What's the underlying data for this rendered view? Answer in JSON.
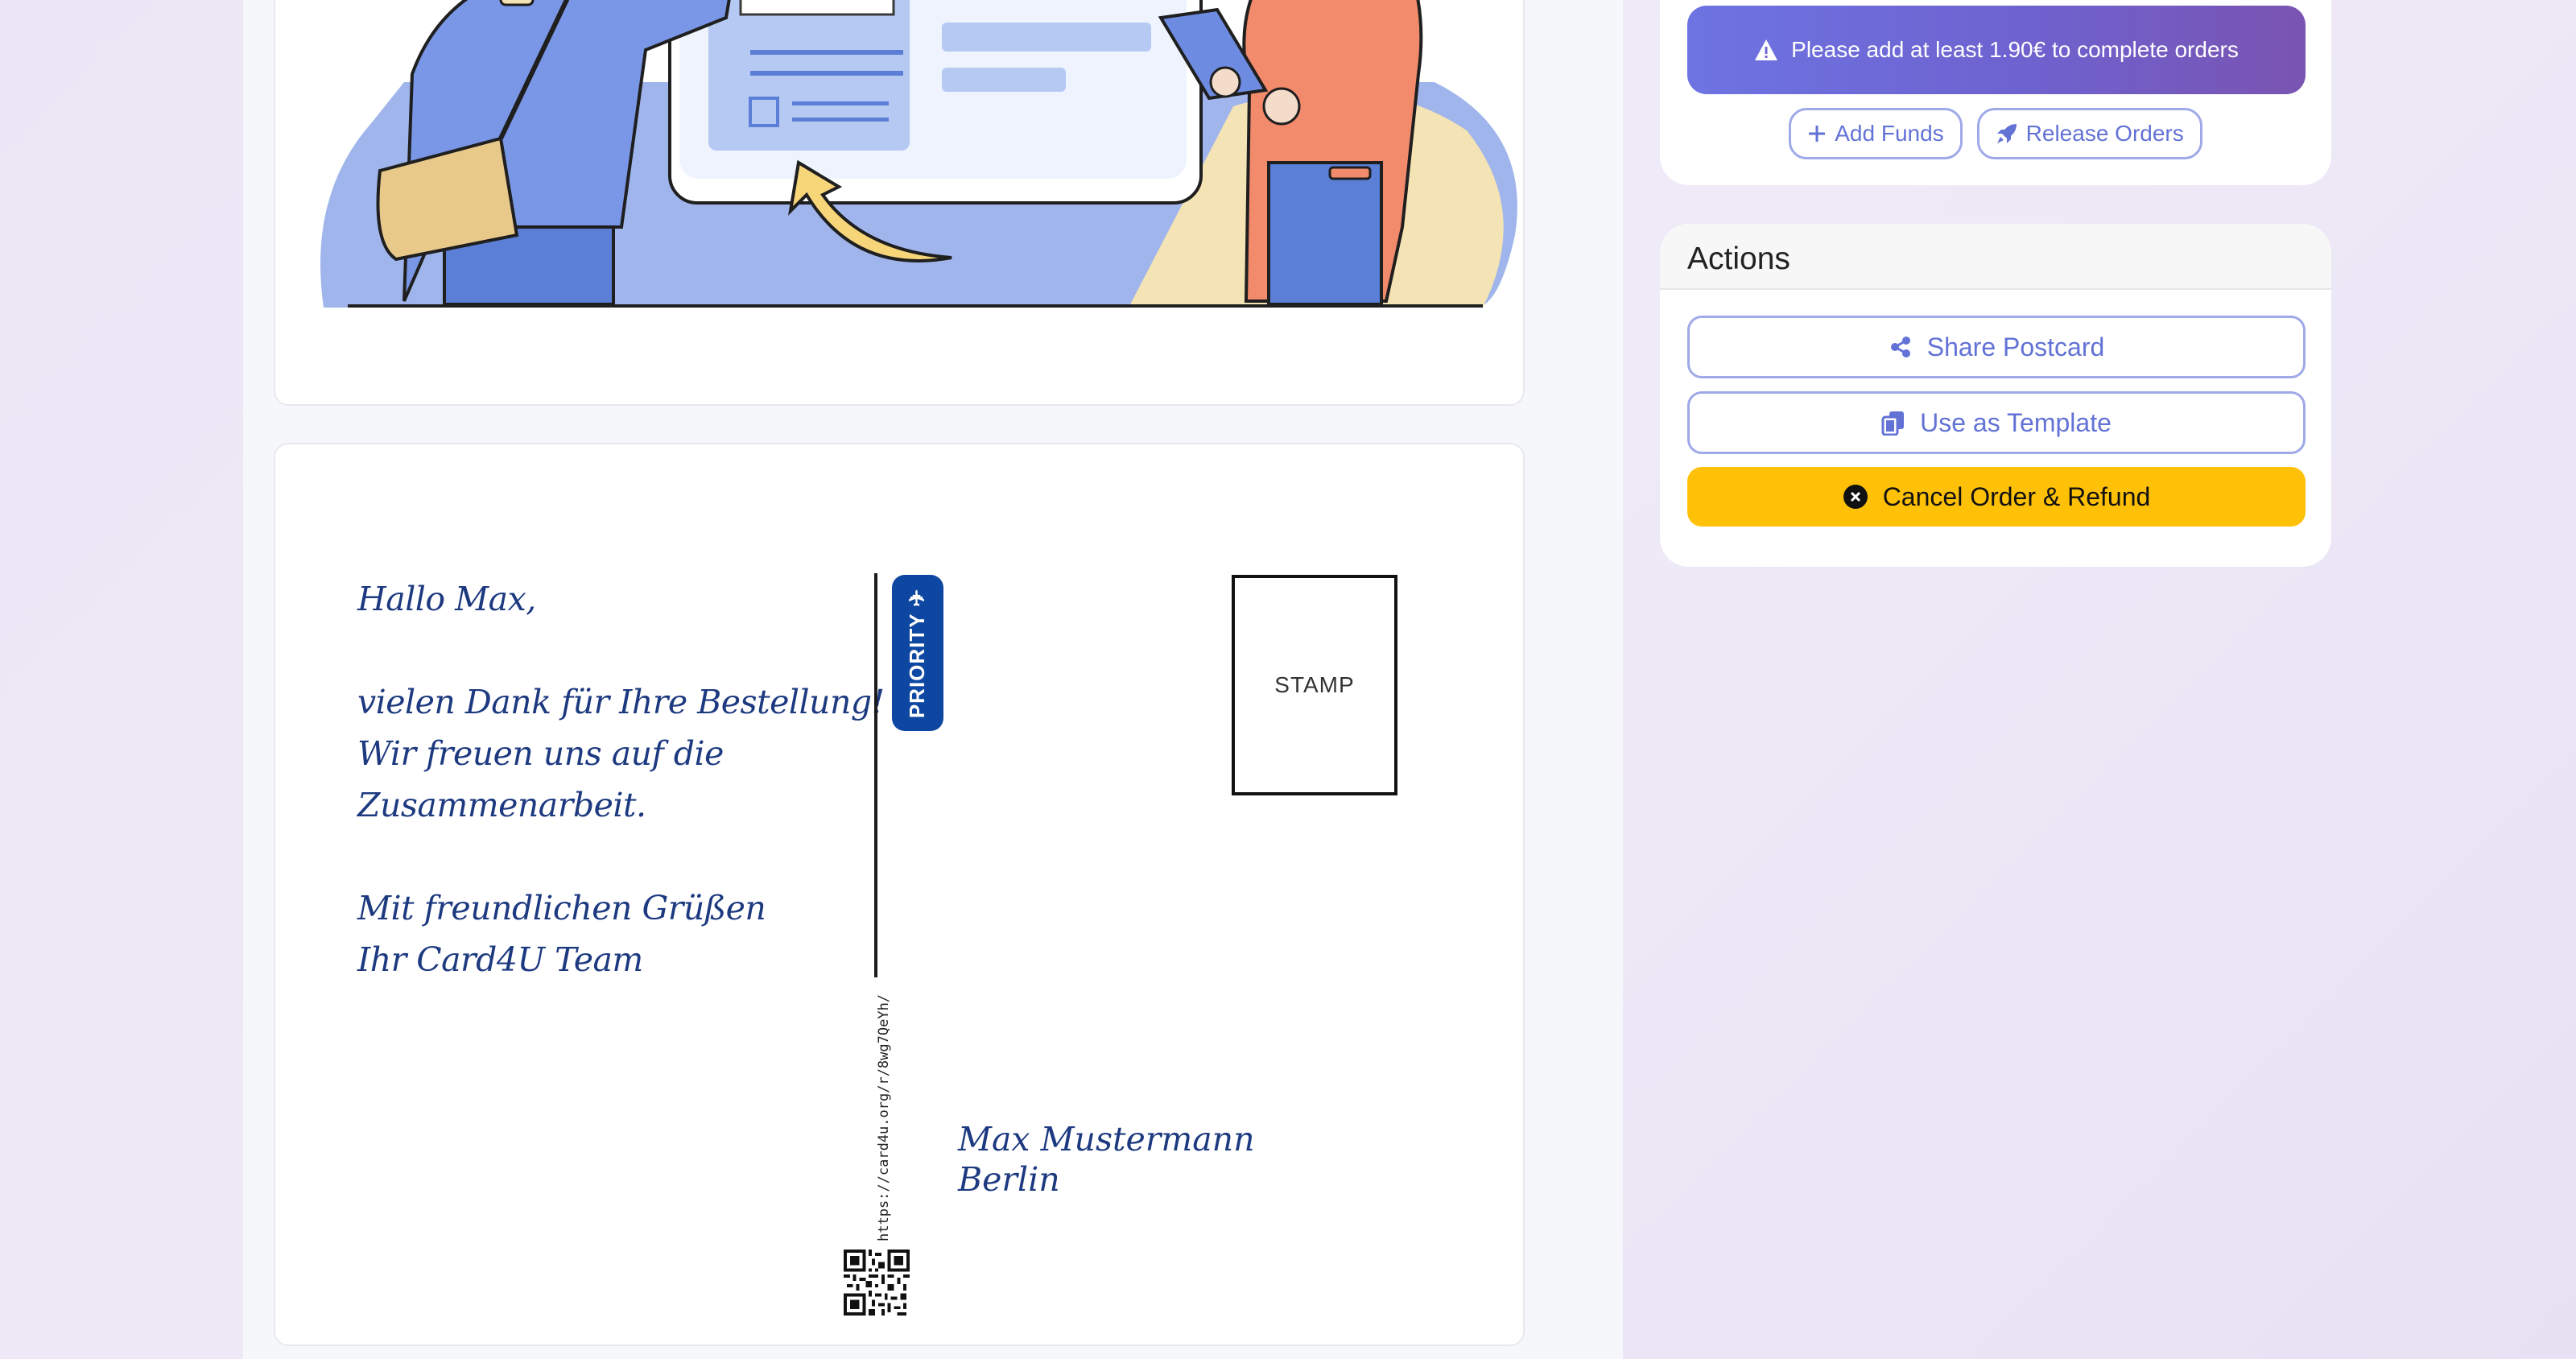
{
  "funds": {
    "alert_text": "Please add at least 1.90€ to complete orders",
    "add_funds_label": "Add Funds",
    "release_orders_label": "Release Orders"
  },
  "actions": {
    "title": "Actions",
    "share_label": "Share Postcard",
    "template_label": "Use as Template",
    "cancel_label": "Cancel Order & Refund"
  },
  "postcard": {
    "greeting": "Hallo Max,",
    "body_lines": [
      "vielen Dank für Ihre Bestellung!",
      "Wir freuen uns auf die",
      "Zusammenarbeit."
    ],
    "closing_lines": [
      "Mit freundlichen Grüßen",
      "Ihr Card4U Team"
    ],
    "priority_label": "PRIORITY ✈",
    "url": "https://card4u.org/r/8wg7QeYh/",
    "stamp_label": "STAMP",
    "recipient_name": "Max Mustermann",
    "recipient_city": "Berlin"
  },
  "colors": {
    "accent": "#6272d5",
    "warning": "#ffc107",
    "priority": "#0d47a1",
    "ink": "#1d3a80"
  },
  "icons": {
    "alert": "warning-triangle-icon",
    "add_funds": "plus-icon",
    "release": "rocket-icon",
    "share": "share-icon",
    "template": "copy-icon",
    "cancel": "close-circle-icon"
  }
}
